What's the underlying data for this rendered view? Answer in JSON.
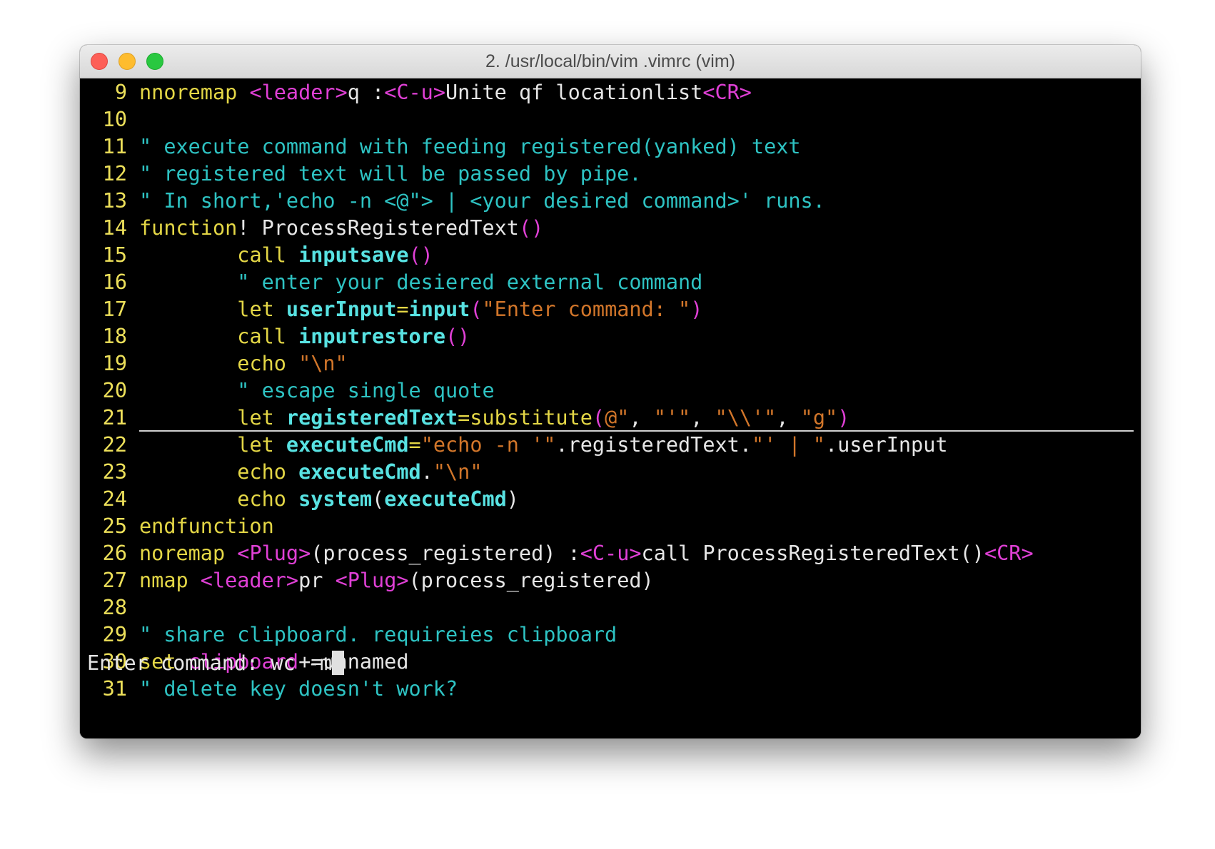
{
  "window": {
    "title": "2. /usr/local/bin/vim .vimrc (vim)"
  },
  "colors": {
    "keyword": "#e4d746",
    "special": "#e040d6",
    "comment": "#2ec3c3",
    "function": "#58e2e2",
    "string": "#d2762a",
    "line_number": "#ede05a",
    "background": "#000000"
  },
  "editor": {
    "current_line": "21",
    "lines": [
      {
        "n": "9",
        "t": [
          [
            "y",
            "nnoremap "
          ],
          [
            "m",
            "<leader>"
          ],
          [
            "w",
            "q :"
          ],
          [
            "m",
            "<C-u>"
          ],
          [
            "w",
            "Unite qf locationlist"
          ],
          [
            "m",
            "<CR>"
          ]
        ]
      },
      {
        "n": "10",
        "t": []
      },
      {
        "n": "11",
        "t": [
          [
            "c",
            "\" execute command with feeding registered(yanked) text"
          ]
        ]
      },
      {
        "n": "12",
        "t": [
          [
            "c",
            "\" registered text will be passed by pipe."
          ]
        ]
      },
      {
        "n": "13",
        "t": [
          [
            "c",
            "\" In short,'echo -n <@\"> | <your desired command>' runs."
          ]
        ]
      },
      {
        "n": "14",
        "t": [
          [
            "y",
            "function"
          ],
          [
            "w",
            "! ProcessRegisteredText"
          ],
          [
            "m",
            "()"
          ]
        ]
      },
      {
        "n": "15",
        "t": [
          [
            "w",
            "        "
          ],
          [
            "y",
            "call "
          ],
          [
            "cb",
            "inputsave"
          ],
          [
            "m",
            "()"
          ]
        ]
      },
      {
        "n": "16",
        "t": [
          [
            "w",
            "        "
          ],
          [
            "c",
            "\" enter your desiered external command"
          ]
        ]
      },
      {
        "n": "17",
        "t": [
          [
            "w",
            "        "
          ],
          [
            "y",
            "let "
          ],
          [
            "cb",
            "userInput"
          ],
          [
            "y",
            "="
          ],
          [
            "cb",
            "input"
          ],
          [
            "m",
            "("
          ],
          [
            "s",
            "\"Enter command: \""
          ],
          [
            "m",
            ")"
          ]
        ]
      },
      {
        "n": "18",
        "t": [
          [
            "w",
            "        "
          ],
          [
            "y",
            "call "
          ],
          [
            "cb",
            "inputrestore"
          ],
          [
            "m",
            "()"
          ]
        ]
      },
      {
        "n": "19",
        "t": [
          [
            "w",
            "        "
          ],
          [
            "y",
            "echo "
          ],
          [
            "s",
            "\"\\n\""
          ]
        ]
      },
      {
        "n": "20",
        "t": [
          [
            "w",
            "        "
          ],
          [
            "c",
            "\" escape single quote"
          ]
        ]
      },
      {
        "n": "21",
        "t": [
          [
            "w",
            "        "
          ],
          [
            "y",
            "let "
          ],
          [
            "cb",
            "registeredText"
          ],
          [
            "y",
            "=substitute"
          ],
          [
            "m",
            "("
          ],
          [
            "s",
            "@\""
          ],
          [
            "w",
            ", "
          ],
          [
            "s",
            "\"'\""
          ],
          [
            "w",
            ", "
          ],
          [
            "s",
            "\"\\\\'\""
          ],
          [
            "w",
            ", "
          ],
          [
            "s",
            "\"g\""
          ],
          [
            "m",
            ")"
          ]
        ]
      },
      {
        "n": "22",
        "t": [
          [
            "w",
            "        "
          ],
          [
            "y",
            "let "
          ],
          [
            "cb",
            "executeCmd"
          ],
          [
            "y",
            "="
          ],
          [
            "s",
            "\"echo -n '\""
          ],
          [
            "w",
            ".registeredText."
          ],
          [
            "s",
            "\"' | \""
          ],
          [
            "w",
            ".userInput"
          ]
        ]
      },
      {
        "n": "23",
        "t": [
          [
            "w",
            "        "
          ],
          [
            "y",
            "echo "
          ],
          [
            "cb",
            "executeCmd"
          ],
          [
            "w",
            "."
          ],
          [
            "s",
            "\"\\n\""
          ]
        ]
      },
      {
        "n": "24",
        "t": [
          [
            "w",
            "        "
          ],
          [
            "y",
            "echo "
          ],
          [
            "cb",
            "system"
          ],
          [
            "w",
            "("
          ],
          [
            "cb",
            "executeCmd"
          ],
          [
            "w",
            ")"
          ]
        ]
      },
      {
        "n": "25",
        "t": [
          [
            "y",
            "endfunction"
          ]
        ]
      },
      {
        "n": "26",
        "t": [
          [
            "y",
            "noremap "
          ],
          [
            "m",
            "<Plug>"
          ],
          [
            "w",
            "(process_registered) :"
          ],
          [
            "m",
            "<C-u>"
          ],
          [
            "w",
            "call ProcessRegisteredText()"
          ],
          [
            "m",
            "<CR>"
          ]
        ]
      },
      {
        "n": "27",
        "t": [
          [
            "y",
            "nmap "
          ],
          [
            "m",
            "<leader>"
          ],
          [
            "w",
            "pr "
          ],
          [
            "m",
            "<Plug>"
          ],
          [
            "w",
            "(process_registered)"
          ]
        ]
      },
      {
        "n": "28",
        "t": []
      },
      {
        "n": "29",
        "t": [
          [
            "c",
            "\" share clipboard. requireies clipboard"
          ]
        ]
      },
      {
        "n": "30",
        "t": [
          [
            "y",
            "set "
          ],
          [
            "m",
            "clipboard"
          ],
          [
            "w",
            "+=unnamed"
          ]
        ]
      },
      {
        "n": "31",
        "t": [
          [
            "c",
            "\" delete key doesn't work?"
          ]
        ]
      }
    ]
  },
  "cmdline": {
    "prompt": "Enter command: ",
    "value": "wc -m"
  }
}
